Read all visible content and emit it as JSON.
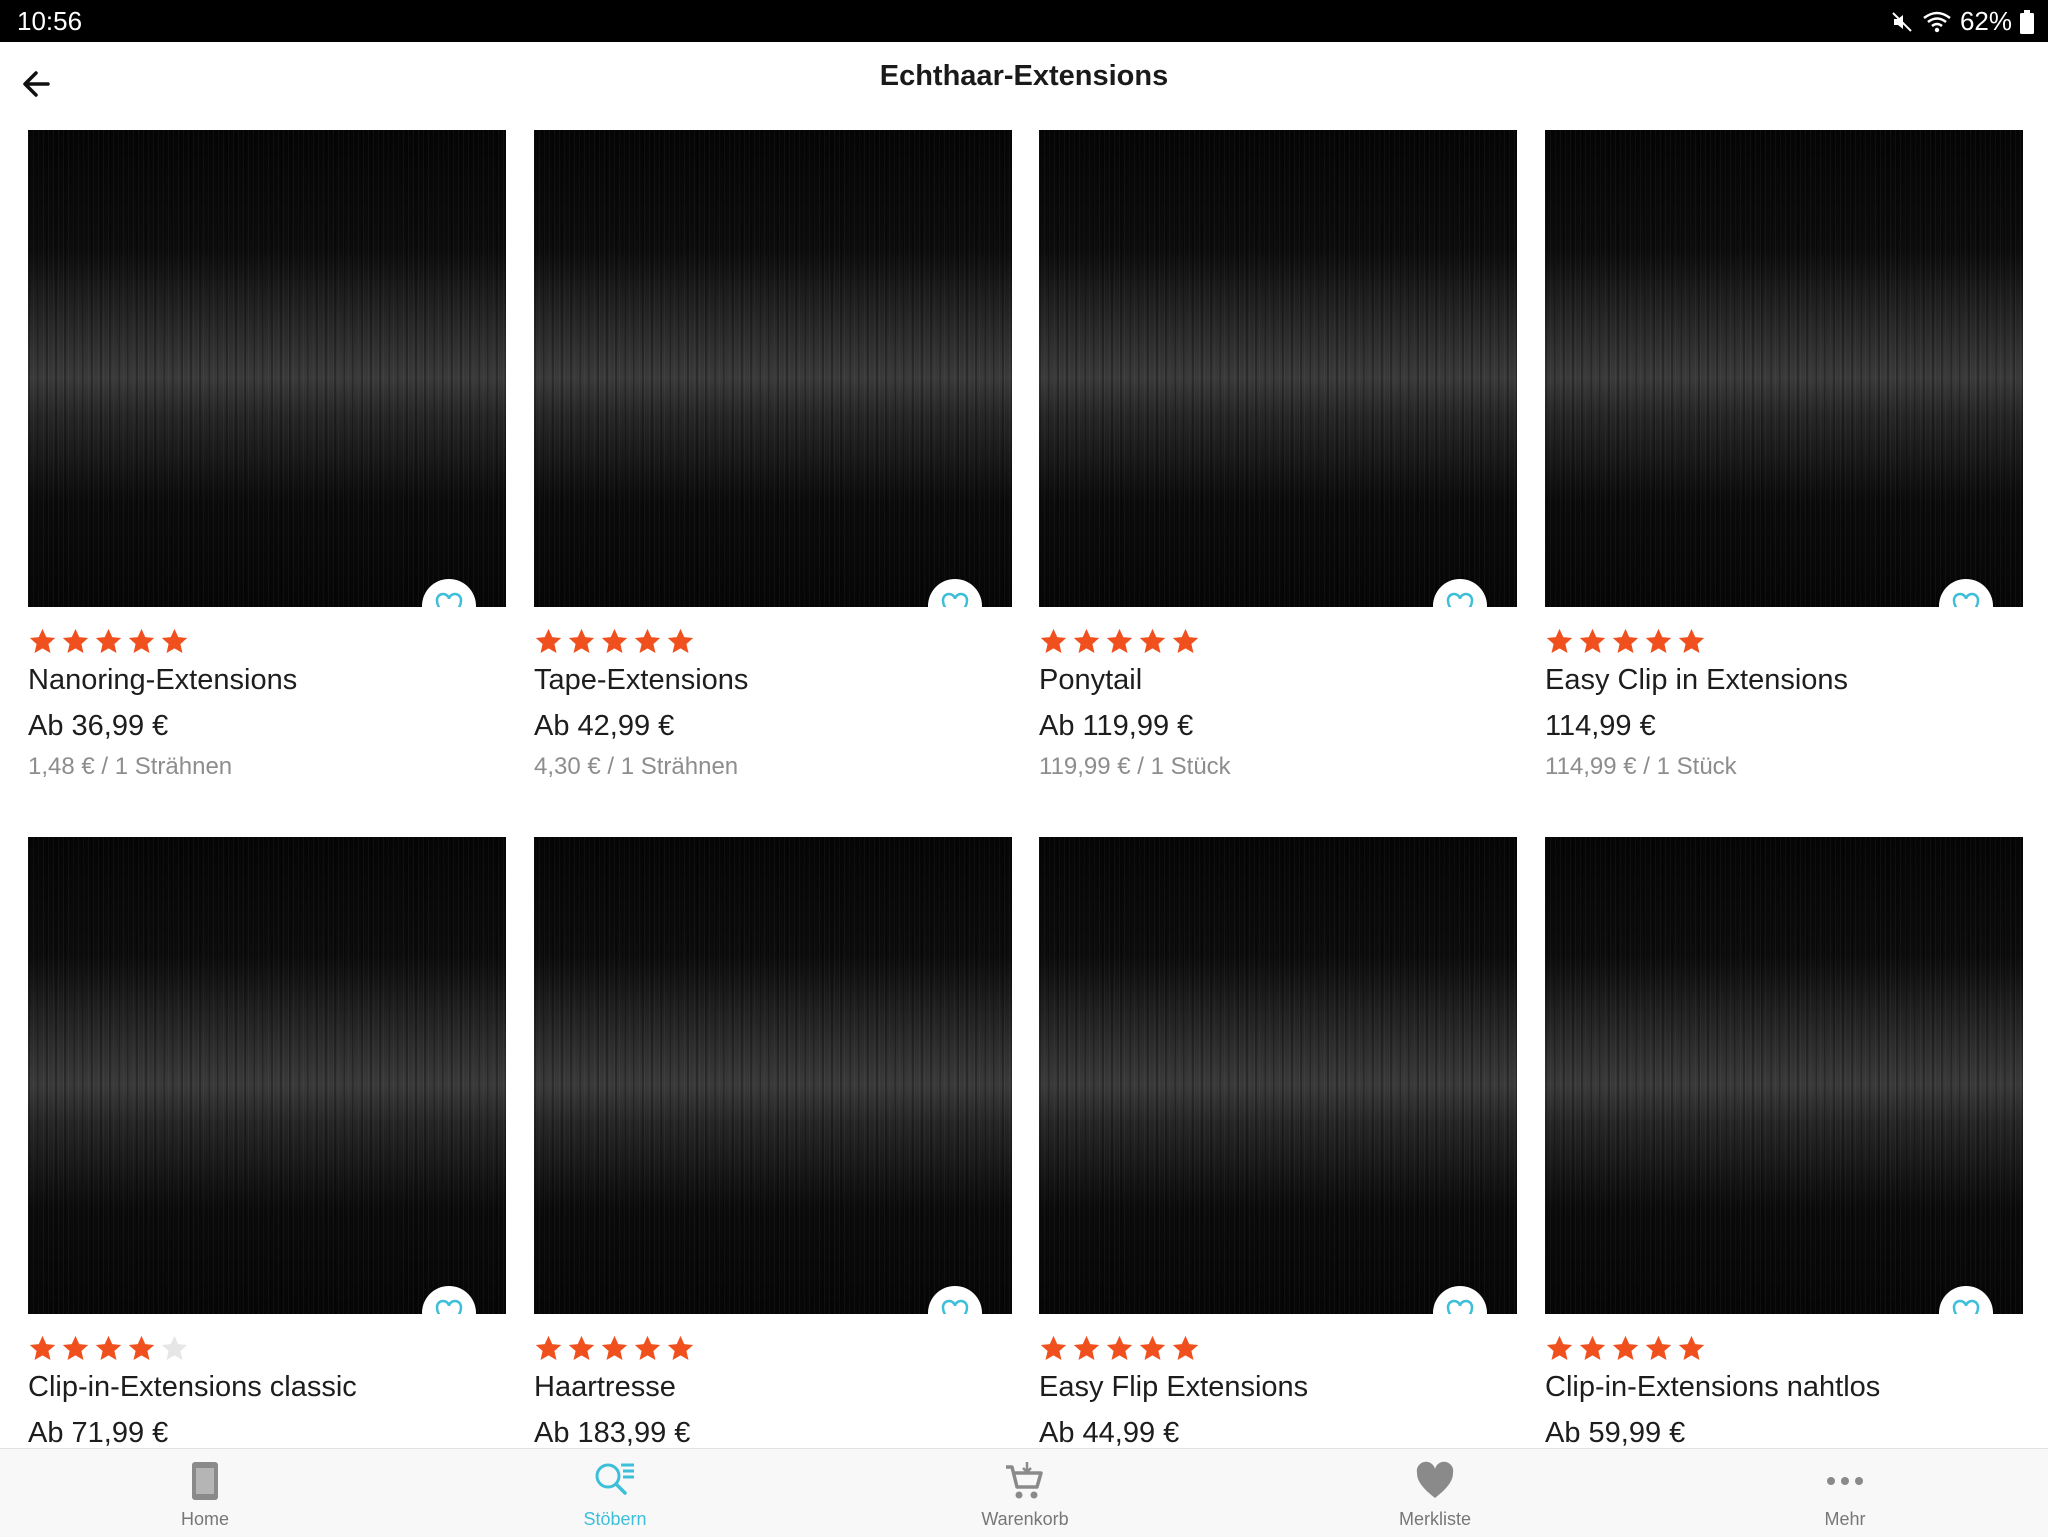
{
  "status_bar": {
    "time": "10:56",
    "battery": "62%"
  },
  "header": {
    "title": "Echthaar-Extensions"
  },
  "products": [
    {
      "name": "Nanoring-Extensions",
      "price": "Ab 36,99 €",
      "unit_price": "1,48 € / 1 Strähnen",
      "rating": 5
    },
    {
      "name": "Tape-Extensions",
      "price": "Ab 42,99 €",
      "unit_price": "4,30 € / 1 Strähnen",
      "rating": 5
    },
    {
      "name": "Ponytail",
      "price": "Ab 119,99 €",
      "unit_price": "119,99 € / 1 Stück",
      "rating": 5
    },
    {
      "name": "Easy Clip in Extensions",
      "price": "114,99 €",
      "unit_price": "114,99 € / 1 Stück",
      "rating": 5
    },
    {
      "name": "Clip-in-Extensions classic",
      "price": "Ab 71,99 €",
      "unit_price": "",
      "rating": 4
    },
    {
      "name": "Haartresse",
      "price": "Ab 183,99 €",
      "unit_price": "",
      "rating": 5
    },
    {
      "name": "Easy Flip Extensions",
      "price": "Ab 44,99 €",
      "unit_price": "",
      "rating": 5
    },
    {
      "name": "Clip-in-Extensions nahtlos",
      "price": "Ab 59,99 €",
      "unit_price": "",
      "rating": 5
    }
  ],
  "bottom_nav": [
    {
      "label": "Home",
      "icon": "home-icon",
      "active": false
    },
    {
      "label": "Stöbern",
      "icon": "search-list-icon",
      "active": true
    },
    {
      "label": "Warenkorb",
      "icon": "cart-icon",
      "active": false
    },
    {
      "label": "Merkliste",
      "icon": "heart-icon",
      "active": false
    },
    {
      "label": "Mehr",
      "icon": "more-icon",
      "active": false
    }
  ],
  "colors": {
    "accent": "#3dbfd9",
    "star": "#f0501e",
    "star_empty": "#e6e6e6",
    "inactive_nav": "#8a8a8a"
  }
}
